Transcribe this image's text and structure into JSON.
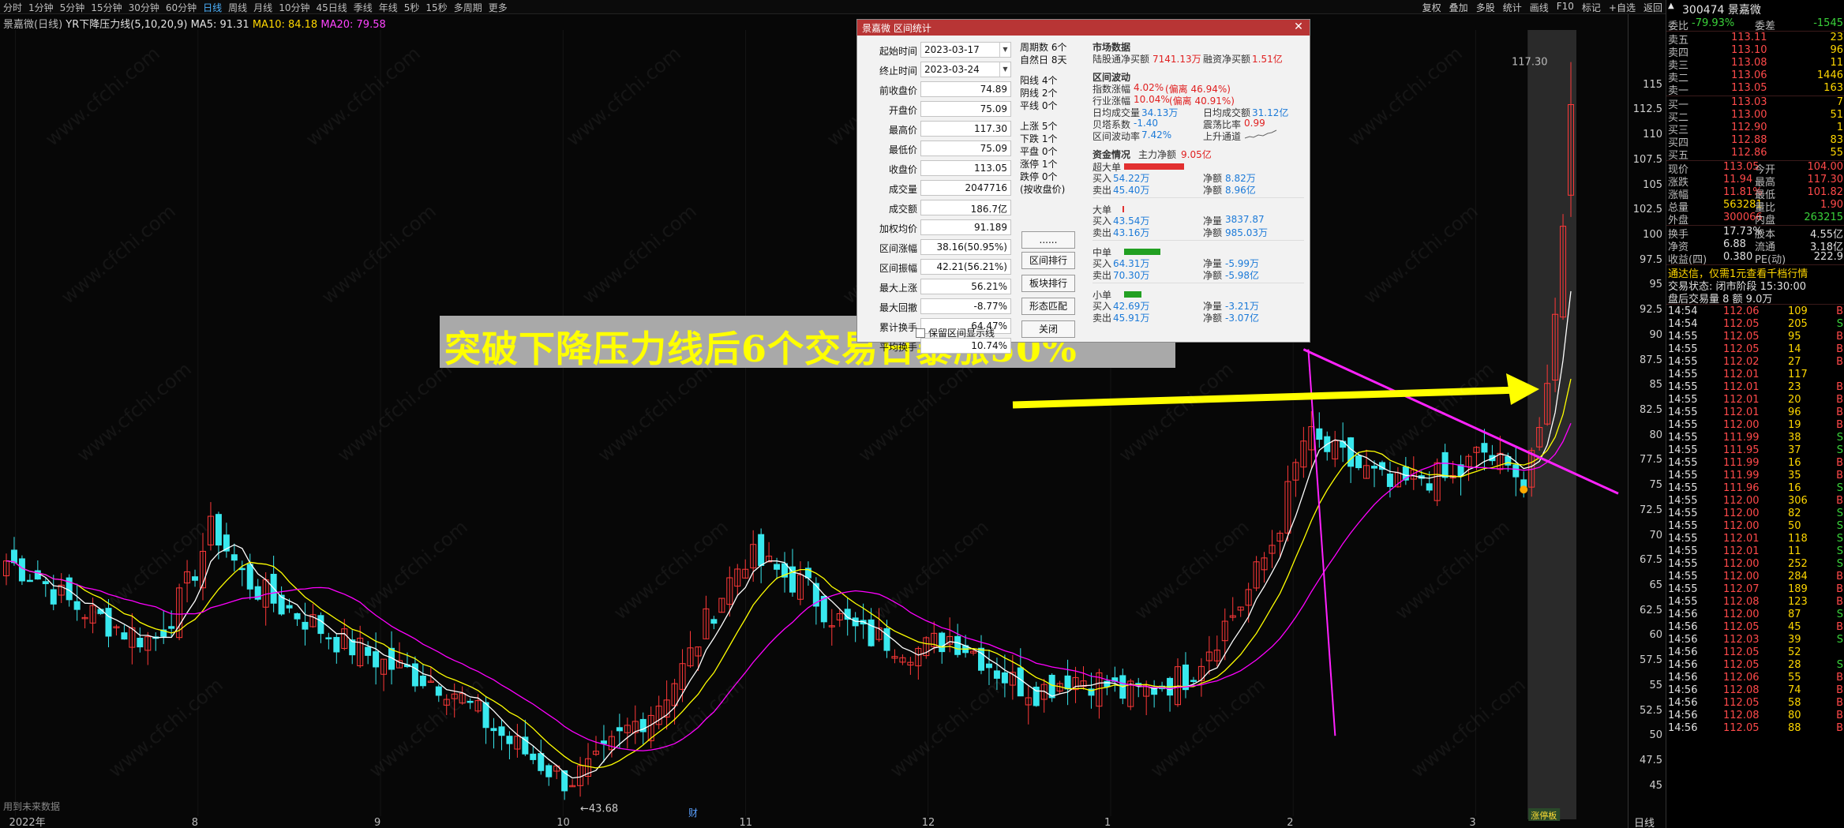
{
  "toolbar": {
    "periods": [
      "分时",
      "1分钟",
      "5分钟",
      "15分钟",
      "30分钟",
      "60分钟",
      "日线",
      "周线",
      "月线",
      "10分钟",
      "45日线",
      "季线",
      "年线",
      "5秒",
      "15秒",
      "多周期",
      "更多"
    ],
    "active_period": "日线",
    "tools": [
      "复权",
      "叠加",
      "多股",
      "统计",
      "画线",
      "F10",
      "标记",
      "+自选",
      "返回"
    ]
  },
  "indicator": {
    "name": "景嘉微(日线)",
    "formula": "YR下降压力线(5,10,20,9)",
    "ma5": "MA5: 91.31",
    "ma10": "MA10: 84.18",
    "ma20": "MA20: 79.58"
  },
  "chart": {
    "month_labels": [
      "2022年",
      "8",
      "9",
      "10",
      "11",
      "12",
      "1",
      "2",
      "3"
    ],
    "high_label": "117.30",
    "low_label": "←43.68",
    "future_label": "用到未来数据",
    "corner_label": "日线",
    "marker_label": "财",
    "tag_label": "涨停板"
  },
  "chart_data": {
    "type": "candlestick",
    "y_ticks": [
      115.0,
      112.5,
      110.0,
      107.5,
      105.0,
      102.5,
      100.0,
      97.5,
      95.0,
      92.5,
      90.0,
      87.5,
      85.0,
      82.5,
      80.0,
      77.5,
      75.0,
      72.5,
      70.0,
      67.5,
      65.0,
      62.5,
      60.0,
      57.5,
      55.0,
      52.5,
      50.0,
      47.5,
      45.0
    ],
    "ylim": [
      43.0,
      120.5
    ],
    "high": 117.3,
    "low": 43.68,
    "series": [
      {
        "name": "MA5",
        "value": 91.31,
        "color": "#ffffff"
      },
      {
        "name": "MA10",
        "value": 84.18,
        "color": "#ffff00"
      },
      {
        "name": "MA20",
        "value": 79.58,
        "color": "#ff00ff"
      }
    ],
    "key_closes": [
      67.5,
      66.0,
      63.5,
      62.0,
      60.5,
      59.5,
      64.0,
      71.0,
      66.0,
      63.5,
      62.0,
      60.0,
      58.5,
      57.0,
      56.0,
      55.0,
      52.0,
      49.5,
      47.5,
      45.5,
      47.0,
      50.5,
      53.0,
      57.0,
      63.0,
      68.0,
      66.5,
      65.0,
      62.0,
      60.0,
      59.5,
      58.5,
      60.0,
      58.0,
      55.5,
      54.5,
      56.0,
      55.5,
      54.0,
      55.0,
      56.0,
      60.0,
      64.0,
      70.0,
      80.0,
      78.0,
      76.5,
      74.5,
      76.0,
      75.5,
      78.5,
      76.0,
      75.0,
      113.05
    ]
  },
  "banner": {
    "text": "突破下降压力线后6个交易日暴涨50%"
  },
  "dialog": {
    "title": "景嘉微 区间统计",
    "fields": [
      {
        "label": "起始时间",
        "value": "2023-03-17",
        "type": "date"
      },
      {
        "label": "终止时间",
        "value": "2023-03-24",
        "type": "date"
      },
      {
        "label": "前收盘价",
        "value": "74.89"
      },
      {
        "label": "开盘价",
        "value": "75.09"
      },
      {
        "label": "最高价",
        "value": "117.30"
      },
      {
        "label": "最低价",
        "value": "75.09"
      },
      {
        "label": "收盘价",
        "value": "113.05"
      },
      {
        "label": "成交量",
        "value": "2047716"
      },
      {
        "label": "成交额",
        "value": "186.7亿"
      },
      {
        "label": "加权均价",
        "value": "91.189"
      },
      {
        "label": "区间涨幅",
        "value": "38.16(50.95%)"
      },
      {
        "label": "区间振幅",
        "value": "42.21(56.21%)"
      },
      {
        "label": "最大上涨",
        "value": "56.21%"
      },
      {
        "label": "最大回撤",
        "value": "-8.77%"
      },
      {
        "label": "累计换手",
        "value": "64.47%"
      },
      {
        "label": "平均换手",
        "value": "10.74%"
      }
    ],
    "checkbox_label": "保留区间显示线",
    "mid": {
      "period_count": "周期数 6个",
      "natural_days": "自然日 8天",
      "yang": "阳线 4个",
      "yin": "阴线 2个",
      "flat": "平线 0个",
      "up": "上涨 5个",
      "down": "下跌 1个",
      "level": "平盘 0个",
      "limit_up": "涨停 1个",
      "limit_down": "跌停 0个",
      "note": "(按收盘价)"
    },
    "buttons": [
      "......",
      "区间排行",
      "板块排行",
      "形态匹配",
      "关闭"
    ],
    "market": {
      "title": "市场数据",
      "hk_label": "陆股通净买额",
      "hk_value": "7141.13万",
      "margin_label": "融资净买额",
      "margin_value": "1.51亿"
    },
    "fluct": {
      "title": "区间波动",
      "index_label": "指数涨幅",
      "index_value": "4.02%",
      "index_dev": "(偏离 46.94%)",
      "industry_label": "行业涨幅",
      "industry_value": "10.04%",
      "industry_dev": "(偏离 40.91%)",
      "daily_vol_label": "日均成交量",
      "daily_vol_value": "34.13万",
      "daily_amt_label": "日均成交额",
      "daily_amt_value": "31.12亿",
      "beta_label": "贝塔系数",
      "beta_value": "-1.40",
      "spread_label": "震荡比率",
      "spread_value": "0.99",
      "volatility_label": "区间波动率",
      "volatility_value": "7.42%",
      "channel_label": "上升通道"
    },
    "funds": {
      "title": "资金情况",
      "main_label": "主力净额",
      "main_value": "9.05亿",
      "groups": [
        {
          "name": "超大单",
          "buy_label": "买入",
          "buy": "54.22万",
          "sell_label": "卖出",
          "sell": "45.40万",
          "net1_label": "净额",
          "net1": "8.82万",
          "net2_label": "净额",
          "net2": "8.96亿",
          "bar_color": "#e23030"
        },
        {
          "name": "大单",
          "buy_label": "买入",
          "buy": "43.54万",
          "sell_label": "卖出",
          "sell": "43.16万",
          "net1_label": "净量",
          "net1": "3837.87",
          "net2_label": "净额",
          "net2": "985.03万",
          "bar_color": "#e23030"
        },
        {
          "name": "中单",
          "buy_label": "买入",
          "buy": "64.31万",
          "sell_label": "卖出",
          "sell": "70.30万",
          "net1_label": "净量",
          "net1": "-5.99万",
          "net2_label": "净额",
          "net2": "-5.98亿",
          "bar_color": "#22a022"
        },
        {
          "name": "小单",
          "buy_label": "买入",
          "buy": "42.69万",
          "sell_label": "卖出",
          "sell": "45.91万",
          "net1_label": "净量",
          "net1": "-3.21万",
          "net2_label": "净额",
          "net2": "-3.07亿",
          "bar_color": "#22a022"
        }
      ]
    }
  },
  "quote": {
    "code_name": "300474 景嘉微",
    "wb_label": "委比",
    "wb_value": "-79.93%",
    "wc_label": "委差",
    "wc_value": "-1545",
    "asks": [
      {
        "label": "卖五",
        "price": "113.11",
        "vol": "23"
      },
      {
        "label": "卖四",
        "price": "113.10",
        "vol": "96"
      },
      {
        "label": "卖三",
        "price": "113.08",
        "vol": "11"
      },
      {
        "label": "卖二",
        "price": "113.06",
        "vol": "1446"
      },
      {
        "label": "卖一",
        "price": "113.05",
        "vol": "163"
      }
    ],
    "bids": [
      {
        "label": "买一",
        "price": "113.03",
        "vol": "7"
      },
      {
        "label": "买二",
        "price": "113.00",
        "vol": "51"
      },
      {
        "label": "买三",
        "price": "112.90",
        "vol": "1"
      },
      {
        "label": "买四",
        "price": "112.88",
        "vol": "83"
      },
      {
        "label": "买五",
        "price": "112.86",
        "vol": "55"
      }
    ],
    "stats": [
      {
        "l1": "现价",
        "v1": "113.05",
        "c1": "red",
        "l2": "今开",
        "v2": "104.00",
        "c2": "red"
      },
      {
        "l1": "涨跌",
        "v1": "11.94",
        "c1": "red",
        "l2": "最高",
        "v2": "117.30",
        "c2": "red"
      },
      {
        "l1": "涨幅",
        "v1": "11.81%",
        "c1": "red",
        "l2": "最低",
        "v2": "101.82",
        "c2": "red"
      },
      {
        "l1": "总量",
        "v1": "563281",
        "c1": "yel",
        "l2": "量比",
        "v2": "1.90",
        "c2": "red"
      },
      {
        "l1": "外盘",
        "v1": "300066",
        "c1": "red",
        "l2": "内盘",
        "v2": "263215",
        "c2": "green"
      },
      {
        "l1": "换手",
        "v1": "17.73%",
        "c1": "white",
        "l2": "股本",
        "v2": "4.55亿",
        "c2": "white"
      },
      {
        "l1": "净资",
        "v1": "6.88",
        "c1": "white",
        "l2": "流通",
        "v2": "3.18亿",
        "c2": "white"
      },
      {
        "l1": "收益(四)",
        "v1": "0.380",
        "c1": "white",
        "l2": "PE(动)",
        "v2": "222.9",
        "c2": "white"
      }
    ],
    "promo": "通达信，仅需1元查看千档行情",
    "trade_status": "交易状态: 闭市阶段 15:30:00",
    "after_hours": "盘后交易量 8 额 9.0万",
    "ticks": [
      {
        "t": "14:54",
        "p": "112.06",
        "v": "109",
        "s": "B"
      },
      {
        "t": "14:54",
        "p": "112.05",
        "v": "205",
        "s": "S"
      },
      {
        "t": "14:55",
        "p": "112.05",
        "v": "95",
        "s": "B"
      },
      {
        "t": "14:55",
        "p": "112.05",
        "v": "14",
        "s": "B"
      },
      {
        "t": "14:55",
        "p": "112.02",
        "v": "27",
        "s": "B"
      },
      {
        "t": "14:55",
        "p": "112.01",
        "v": "117",
        "s": ""
      },
      {
        "t": "14:55",
        "p": "112.01",
        "v": "23",
        "s": "B"
      },
      {
        "t": "14:55",
        "p": "112.01",
        "v": "20",
        "s": "B"
      },
      {
        "t": "14:55",
        "p": "112.01",
        "v": "96",
        "s": "B"
      },
      {
        "t": "14:55",
        "p": "112.00",
        "v": "19",
        "s": "B"
      },
      {
        "t": "14:55",
        "p": "111.99",
        "v": "38",
        "s": "S"
      },
      {
        "t": "14:55",
        "p": "111.95",
        "v": "37",
        "s": "S"
      },
      {
        "t": "14:55",
        "p": "111.99",
        "v": "16",
        "s": "B"
      },
      {
        "t": "14:55",
        "p": "111.99",
        "v": "35",
        "s": "B"
      },
      {
        "t": "14:55",
        "p": "111.96",
        "v": "16",
        "s": "S"
      },
      {
        "t": "14:55",
        "p": "112.00",
        "v": "306",
        "s": "B"
      },
      {
        "t": "14:55",
        "p": "112.00",
        "v": "82",
        "s": "S"
      },
      {
        "t": "14:55",
        "p": "112.00",
        "v": "50",
        "s": "S"
      },
      {
        "t": "14:55",
        "p": "112.01",
        "v": "118",
        "s": "S"
      },
      {
        "t": "14:55",
        "p": "112.01",
        "v": "11",
        "s": "S"
      },
      {
        "t": "14:55",
        "p": "112.00",
        "v": "252",
        "s": "S"
      },
      {
        "t": "14:55",
        "p": "112.00",
        "v": "284",
        "s": "B"
      },
      {
        "t": "14:55",
        "p": "112.07",
        "v": "189",
        "s": "B"
      },
      {
        "t": "14:55",
        "p": "112.08",
        "v": "123",
        "s": "B"
      },
      {
        "t": "14:56",
        "p": "112.00",
        "v": "87",
        "s": "S"
      },
      {
        "t": "14:56",
        "p": "112.05",
        "v": "45",
        "s": "B"
      },
      {
        "t": "14:56",
        "p": "112.03",
        "v": "39",
        "s": "S"
      },
      {
        "t": "14:56",
        "p": "112.05",
        "v": "52",
        "s": ""
      },
      {
        "t": "14:56",
        "p": "112.05",
        "v": "28",
        "s": "S"
      },
      {
        "t": "14:56",
        "p": "112.06",
        "v": "55",
        "s": "B"
      },
      {
        "t": "14:56",
        "p": "112.08",
        "v": "74",
        "s": "B"
      },
      {
        "t": "14:56",
        "p": "112.05",
        "v": "58",
        "s": "B"
      },
      {
        "t": "14:56",
        "p": "112.08",
        "v": "80",
        "s": "B"
      },
      {
        "t": "14:56",
        "p": "112.05",
        "v": "88",
        "s": "B"
      }
    ]
  }
}
